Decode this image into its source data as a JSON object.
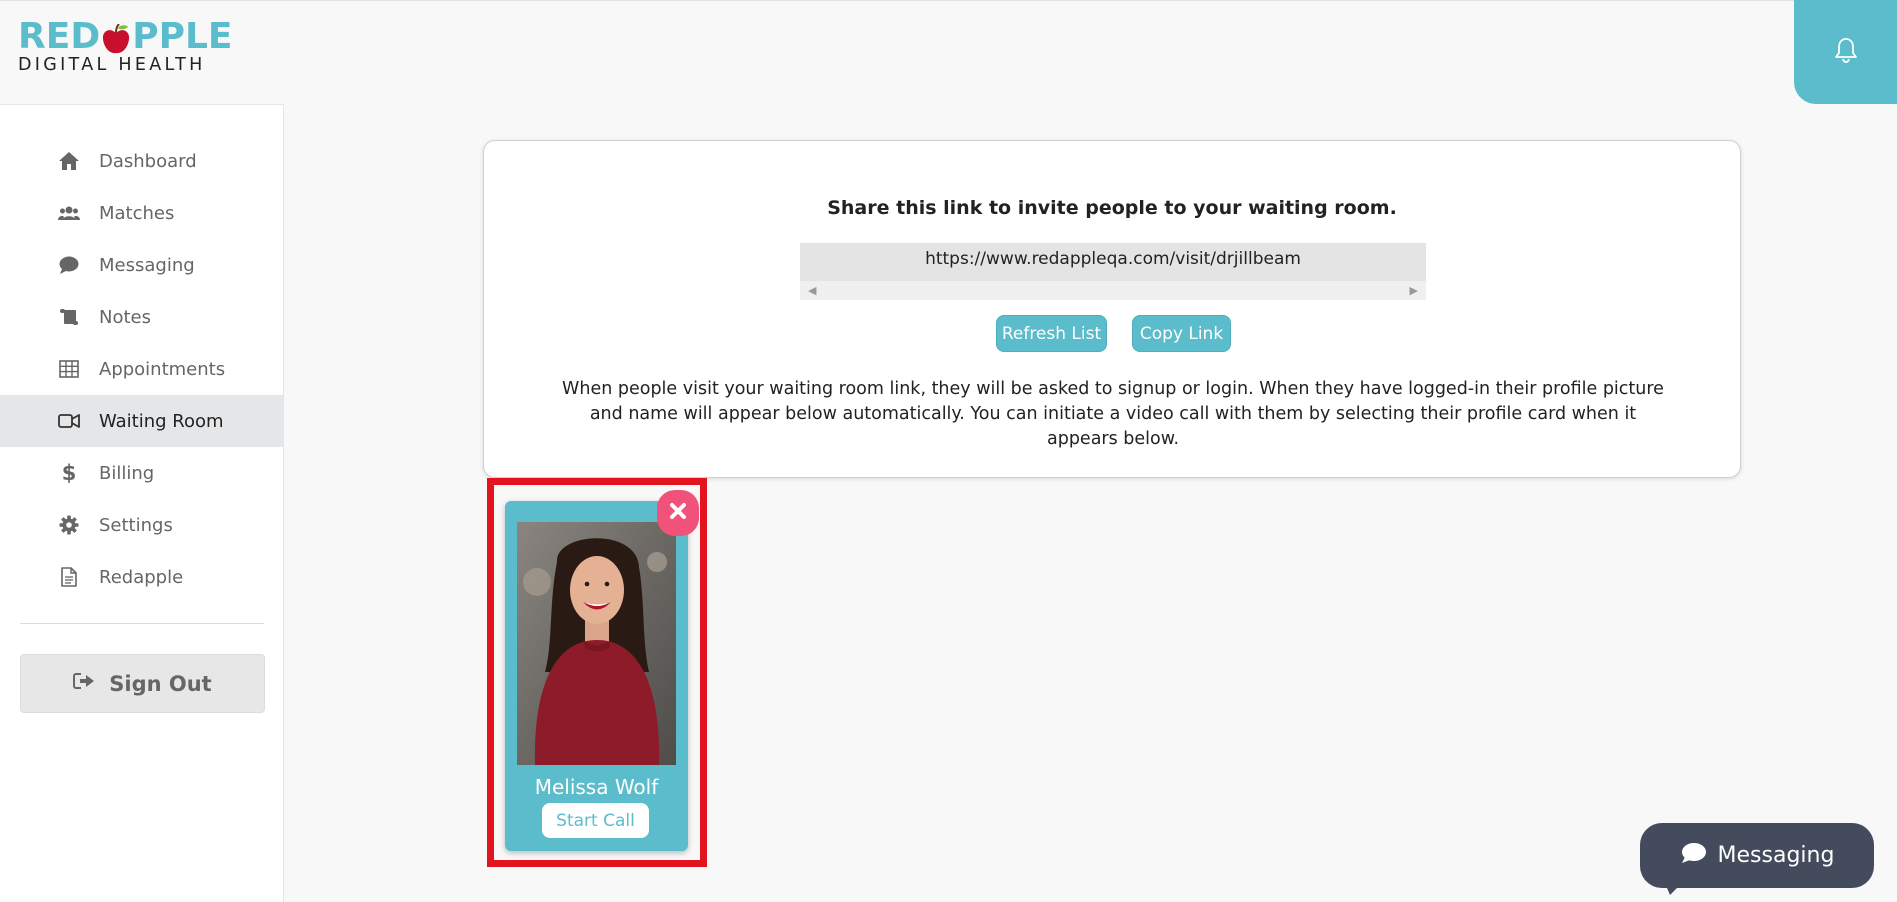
{
  "brand": {
    "name": "REDAPPLE",
    "name_left": "RED",
    "name_right": "PPLE",
    "tagline": "DIGITAL HEALTH",
    "accent_color": "#5bbccc",
    "apple_color": "#c8102e"
  },
  "header": {
    "notifications_icon": "bell-icon"
  },
  "sidebar": {
    "items": [
      {
        "label": "Dashboard",
        "icon": "home-icon",
        "active": false
      },
      {
        "label": "Matches",
        "icon": "users-icon",
        "active": false
      },
      {
        "label": "Messaging",
        "icon": "comment-icon",
        "active": false
      },
      {
        "label": "Notes",
        "icon": "scroll-icon",
        "active": false
      },
      {
        "label": "Appointments",
        "icon": "table-icon",
        "active": false
      },
      {
        "label": "Waiting Room",
        "icon": "video-icon",
        "active": true
      },
      {
        "label": "Billing",
        "icon": "dollar-icon",
        "active": false
      },
      {
        "label": "Settings",
        "icon": "gear-icon",
        "active": false
      },
      {
        "label": "Redapple",
        "icon": "document-icon",
        "active": false
      }
    ],
    "sign_out_label": "Sign Out"
  },
  "waiting_room": {
    "share_title": "Share this link to invite people to your waiting room.",
    "share_link": "https://www.redappleqa.com/visit/drjillbeam",
    "refresh_label": "Refresh List",
    "copy_label": "Copy Link",
    "description": "When people visit your waiting room link, they will be asked to signup or login. When they have logged-in their profile picture and name will appear below automatically. You can initiate a video call with them by selecting their profile card when it appears below."
  },
  "profiles": [
    {
      "name": "Melissa Wolf",
      "start_call_label": "Start Call"
    }
  ],
  "messaging_fab": {
    "label": "Messaging"
  },
  "colors": {
    "teal": "#5bbccc",
    "highlight_red": "#e3141e",
    "close_pink": "#f0527a",
    "fab_dark": "#434b5c"
  }
}
